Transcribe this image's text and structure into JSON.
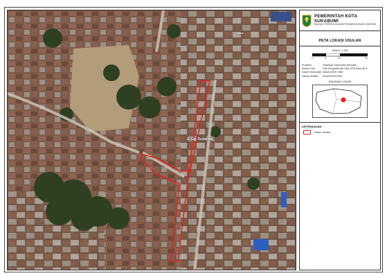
{
  "header": {
    "org_name": "PEMERINTAH KOTA SUKABUMI",
    "org_sub": "BADAN PERENCANAAN PEMBANGUNAN DAERAH"
  },
  "map_title": "PETA LOKASI USULAN",
  "scale": {
    "label": "SKALA : 1:200",
    "ticks": [
      "0",
      "5",
      "10",
      "20"
    ]
  },
  "info": [
    {
      "key": "Proyeksi",
      "val": "Universal Transverse Mercator"
    },
    {
      "key": "Sistem Grid",
      "val": "Grid Geografis dan Grid UTM Zone 48 S"
    },
    {
      "key": "Datum Horizontal",
      "val": "Datum WGS 1984"
    },
    {
      "key": "Datum Vertikal",
      "val": "Geoid EGM 2008"
    }
  ],
  "inset_title": "DIAGRAM LOKASI",
  "legend": {
    "title": "KETERANGAN :",
    "items": [
      {
        "label": "Lokasi Usulan",
        "color": "#e3231f"
      }
    ]
  },
  "map": {
    "street_labels": [
      "Jalan",
      "Jl. Gg. Sudarma"
    ],
    "boundary_color": "#e3231f"
  }
}
